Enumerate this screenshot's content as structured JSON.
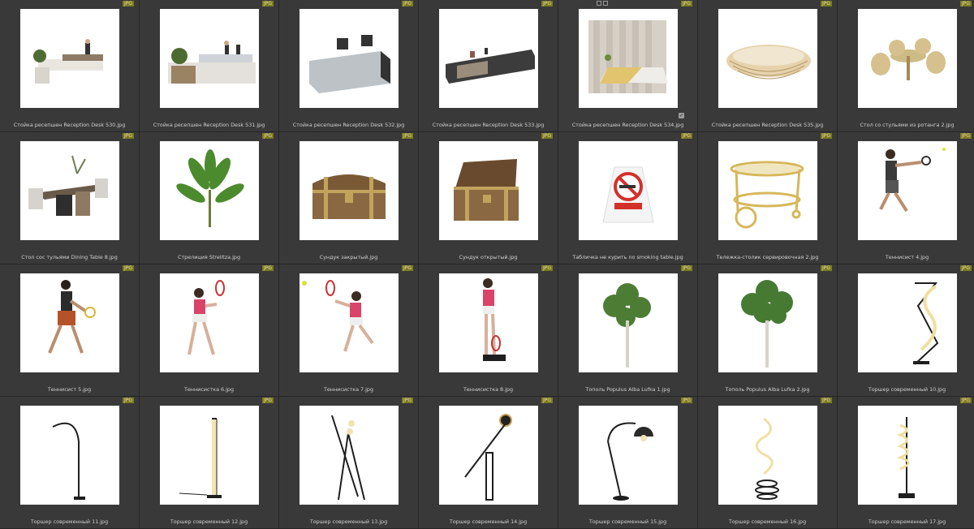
{
  "badge": "JPG",
  "items": [
    {
      "label": "Стойка ресепшен Reception Desk 530.jpg",
      "icon": "reception-desk-icon"
    },
    {
      "label": "Стойка ресепшен Reception Desk 531.jpg",
      "icon": "reception-desk-icon"
    },
    {
      "label": "Стойка ресепшен Reception Desk 532.jpg",
      "icon": "reception-desk-icon"
    },
    {
      "label": "Стойка ресепшен Reception Desk 533.jpg",
      "icon": "reception-desk-icon"
    },
    {
      "label": "Стойка ресепшен Reception Desk 534.jpg",
      "icon": "reception-desk-icon"
    },
    {
      "label": "Стойка ресепшен Reception Desk 535.jpg",
      "icon": "reception-desk-icon"
    },
    {
      "label": "Стол со стульями из ротанга 2.jpg",
      "icon": "rattan-table-icon"
    },
    {
      "label": "Стол сос тульями Dining Table 8.jpg",
      "icon": "dining-table-icon"
    },
    {
      "label": "Стрелиция Strelitza.jpg",
      "icon": "plant-icon"
    },
    {
      "label": "Сундук закрытый.jpg",
      "icon": "chest-icon"
    },
    {
      "label": "Сундук открытый.jpg",
      "icon": "open-chest-icon"
    },
    {
      "label": "Табличка не курить no smoking table.jpg",
      "icon": "no-smoking-sign-icon"
    },
    {
      "label": "Тележка-столик сервировочная 2.jpg",
      "icon": "serving-cart-icon"
    },
    {
      "label": "Теннисист 4.jpg",
      "icon": "tennis-player-icon"
    },
    {
      "label": "Теннисист 5.jpg",
      "icon": "tennis-player-icon"
    },
    {
      "label": "Теннисистка 6.jpg",
      "icon": "tennis-player-icon"
    },
    {
      "label": "Теннисистка 7.jpg",
      "icon": "tennis-player-icon"
    },
    {
      "label": "Теннисистка 8.jpg",
      "icon": "tennis-player-icon"
    },
    {
      "label": "Тополь Populus Alba Lufka 1.jpg",
      "icon": "tree-icon"
    },
    {
      "label": "Тополь Populus Alba Lufka 2.jpg",
      "icon": "tree-icon"
    },
    {
      "label": "Торшер современный 10.jpg",
      "icon": "floor-lamp-icon"
    },
    {
      "label": "Торшер современный 11.jpg",
      "icon": "floor-lamp-icon"
    },
    {
      "label": "Торшер современный 12.jpg",
      "icon": "floor-lamp-icon"
    },
    {
      "label": "Торшер современный 13.jpg",
      "icon": "floor-lamp-icon"
    },
    {
      "label": "Торшер современный 14.jpg",
      "icon": "floor-lamp-icon"
    },
    {
      "label": "Торшер современный 15.jpg",
      "icon": "floor-lamp-icon"
    },
    {
      "label": "Торшер современный 16.jpg",
      "icon": "floor-lamp-icon"
    },
    {
      "label": "Торшер современный 17.jpg",
      "icon": "floor-lamp-icon"
    }
  ]
}
